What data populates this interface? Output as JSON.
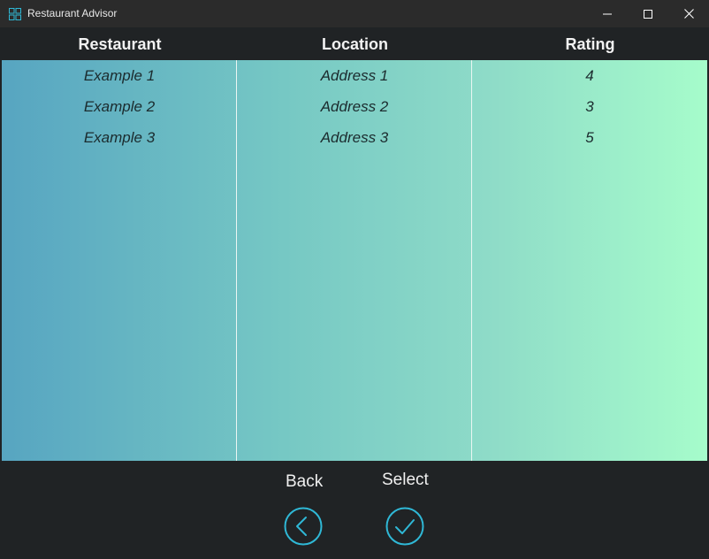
{
  "window": {
    "title": "Restaurant Advisor"
  },
  "grid": {
    "columns": [
      "Restaurant",
      "Location",
      "Rating"
    ],
    "rows": [
      {
        "restaurant": "Example 1",
        "location": "Address 1",
        "rating": "4"
      },
      {
        "restaurant": "Example 2",
        "location": "Address 2",
        "rating": "3"
      },
      {
        "restaurant": "Example 3",
        "location": "Address 3",
        "rating": "5"
      }
    ]
  },
  "footer": {
    "back_label": "Back",
    "select_label": "Select",
    "back_icon": "chevron-left-circle-icon",
    "select_icon": "checkmark-circle-icon"
  },
  "colors": {
    "accent": "#2fb8d6",
    "gradient_start": "#57a5c1",
    "gradient_end": "#a6fccb"
  }
}
